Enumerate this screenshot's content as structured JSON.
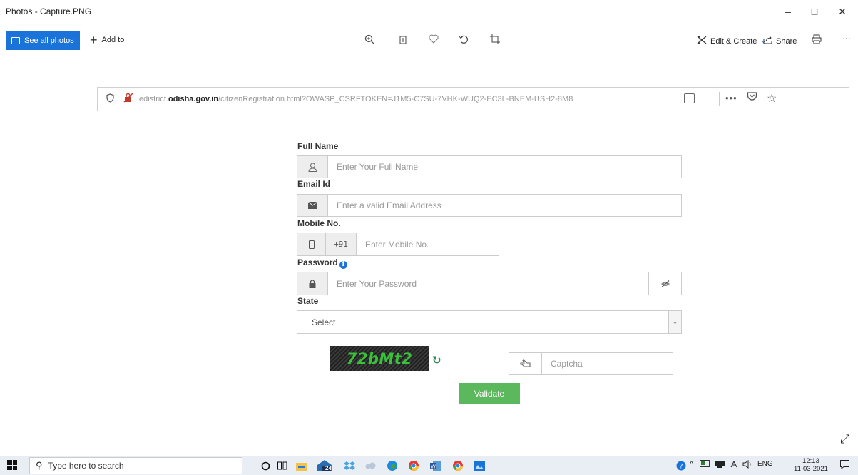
{
  "window": {
    "title": "Photos - Capture.PNG",
    "controls": {
      "minimize": "–",
      "maximize": "□",
      "close": "✕"
    }
  },
  "toolbar": {
    "see_all": "See all photos",
    "add_to": "Add to",
    "edit_create": "Edit & Create",
    "share": "Share",
    "more": "···"
  },
  "browser": {
    "url_prefix": "edistrict.",
    "url_domain": "odisha.gov.in",
    "url_path": "/citizenRegistration.html?OWASP_CSRFTOKEN=J1M5-C7SU-7VHK-WUQ2-EC3L-BNEM-USH2-8M8",
    "more": "•••"
  },
  "form": {
    "full_name": {
      "label": "Full Name",
      "placeholder": "Enter Your Full Name"
    },
    "email": {
      "label": "Email Id",
      "placeholder": "Enter a valid Email Address"
    },
    "mobile": {
      "label": "Mobile No.",
      "country_code": "+91",
      "placeholder": "Enter Mobile No."
    },
    "password": {
      "label": "Password",
      "info_glyph": "i",
      "placeholder": "Enter Your Password"
    },
    "state": {
      "label": "State",
      "selected": "Select"
    },
    "captcha": {
      "text": "72bMt2",
      "refresh_glyph": "↻",
      "placeholder": "Captcha"
    },
    "validate_label": "Validate"
  },
  "taskbar": {
    "search_placeholder": "Type here to search",
    "weather_badge": "24",
    "language": "ENG",
    "time": "12:13",
    "date": "11-03-2021"
  }
}
